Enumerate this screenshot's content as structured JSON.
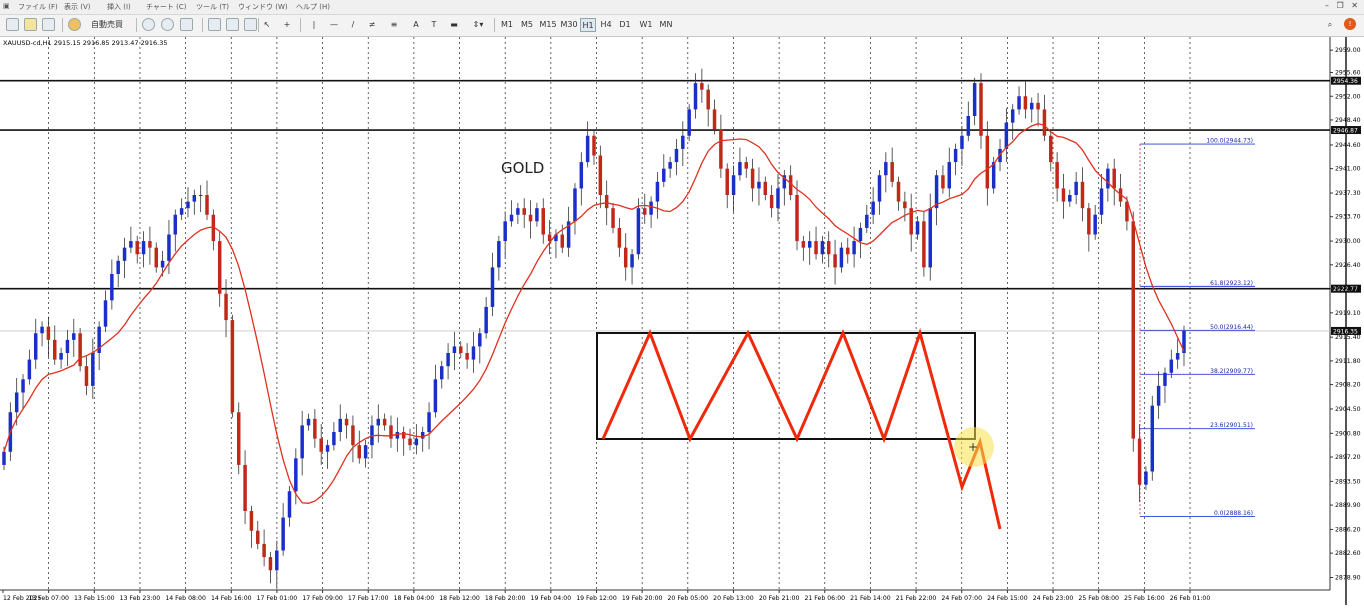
{
  "menu": [
    "ファイル (F)",
    "表示 (V)",
    "挿入 (I)",
    "チャート (C)",
    "ツール (T)",
    "ウィンドウ (W)",
    "ヘルプ (H)"
  ],
  "toolbar": {
    "autotrade_label": "自動売買",
    "timeframes": [
      "M1",
      "M5",
      "M15",
      "M30",
      "H1",
      "H4",
      "D1",
      "W1",
      "MN"
    ],
    "active_timeframe": "H1"
  },
  "chart_header": "XAUUSD-cd,H1  2915.15 2916.85 2913.47 2916.35",
  "annotation_gold": "GOLD",
  "price_axis": {
    "ticks": [
      "2959.00",
      "2955.60",
      "2952.00",
      "2948.40",
      "2944.60",
      "2941.00",
      "2937.30",
      "2933.70",
      "2930.00",
      "2926.40",
      "2922.77",
      "2919.10",
      "2915.40",
      "2911.80",
      "2908.20",
      "2904.50",
      "2900.80",
      "2897.20",
      "2893.50",
      "2889.90",
      "2886.20",
      "2882.60",
      "2878.90"
    ],
    "hline_labels": [
      "2954.36",
      "2946.87",
      "2922.77"
    ],
    "current_price": "2916.35"
  },
  "time_axis": [
    "12 Feb 2025",
    "13 Feb 07:00",
    "13 Feb 15:00",
    "13 Feb 23:00",
    "14 Feb 08:00",
    "14 Feb 16:00",
    "17 Feb 01:00",
    "17 Feb 09:00",
    "17 Feb 17:00",
    "18 Feb 04:00",
    "18 Feb 12:00",
    "18 Feb 20:00",
    "19 Feb 04:00",
    "19 Feb 12:00",
    "19 Feb 20:00",
    "20 Feb 05:00",
    "20 Feb 13:00",
    "20 Feb 21:00",
    "21 Feb 06:00",
    "21 Feb 14:00",
    "21 Feb 22:00",
    "24 Feb 07:00",
    "24 Feb 15:00",
    "24 Feb 23:00",
    "25 Feb 08:00",
    "25 Feb 16:00",
    "26 Feb 01:00"
  ],
  "fibo_levels": [
    "100.0(2944.73)",
    "61.8(2923.12)",
    "50.0(2916.44)",
    "38.2(2909.77)",
    "23.6(2901.51)",
    "0.0(2888.16)"
  ],
  "chart_data": {
    "type": "candlestick",
    "symbol": "XAUUSD-cd",
    "timeframe": "H1",
    "ohlc_last": {
      "open": 2915.15,
      "high": 2916.85,
      "low": 2913.47,
      "close": 2916.35
    },
    "ylim": [
      2877.0,
      2961.0
    ],
    "horizontal_lines": [
      2954.36,
      2946.87,
      2922.77
    ],
    "fibonacci": [
      {
        "level": 100.0,
        "price": 2944.73
      },
      {
        "level": 61.8,
        "price": 2923.12
      },
      {
        "level": 50.0,
        "price": 2916.44
      },
      {
        "level": 38.2,
        "price": 2909.77
      },
      {
        "level": 23.6,
        "price": 2901.51
      },
      {
        "level": 0.0,
        "price": 2888.16
      }
    ],
    "closes": [
      2898,
      2904,
      2907,
      2909,
      2912,
      2916,
      2917,
      2915,
      2912,
      2913,
      2915,
      2916,
      2911,
      2908,
      2913,
      2917,
      2921,
      2925,
      2927,
      2929,
      2930,
      2928,
      2930,
      2929,
      2926,
      2927,
      2931,
      2934,
      2935,
      2936,
      2937,
      2937,
      2934,
      2930,
      2922,
      2918,
      2904,
      2896,
      2889,
      2886,
      2884,
      2882,
      2880,
      2883,
      2888,
      2892,
      2897,
      2902,
      2903,
      2900,
      2898,
      2899,
      2901,
      2903,
      2902,
      2899,
      2897,
      2899,
      2902,
      2903,
      2902,
      2900,
      2901,
      2900,
      2899,
      2900,
      2901,
      2904,
      2909,
      2911,
      2913,
      2914,
      2913,
      2912,
      2914,
      2916,
      2920,
      2926,
      2930,
      2933,
      2934,
      2935,
      2934,
      2933,
      2935,
      2931,
      2930,
      2931,
      2929,
      2933,
      2938,
      2942,
      2946,
      2943,
      2937,
      2935,
      2932,
      2929,
      2926,
      2928,
      2935,
      2934,
      2936,
      2939,
      2941,
      2942,
      2944,
      2946,
      2950,
      2954,
      2953,
      2950,
      2947,
      2941,
      2937,
      2940,
      2942,
      2941,
      2938,
      2939,
      2937,
      2935,
      2938,
      2940,
      2937,
      2930,
      2929,
      2930,
      2928,
      2930,
      2928,
      2926,
      2929,
      2928,
      2930,
      2932,
      2934,
      2936,
      2940,
      2942,
      2939,
      2936,
      2935,
      2931,
      2933,
      2926,
      2935,
      2940,
      2938,
      2942,
      2944,
      2946,
      2949,
      2954,
      2946,
      2938,
      2942,
      2944,
      2948,
      2950,
      2952,
      2950,
      2951,
      2950,
      2946,
      2942,
      2938,
      2936,
      2937,
      2939,
      2935,
      2931,
      2934,
      2938,
      2941,
      2938,
      2936,
      2933,
      2900,
      2893,
      2895,
      2905,
      2908,
      2910,
      2912,
      2913,
      2916.35
    ],
    "ma_period_note": "",
    "ma_color": "#e03020",
    "bull_color": "#1a2fc8",
    "bear_color": "#c0281a"
  }
}
